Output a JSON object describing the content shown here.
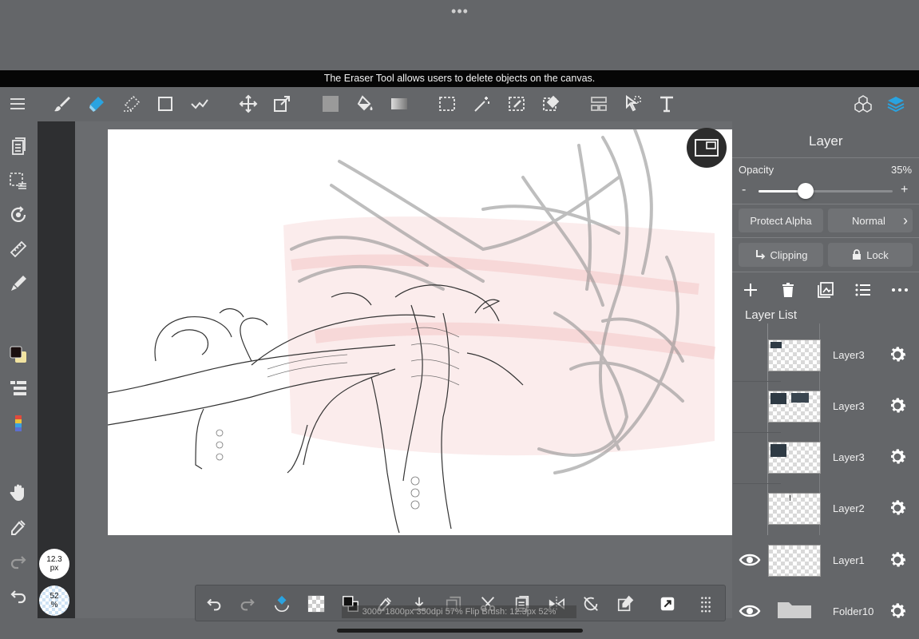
{
  "app": {
    "multitask_dots": "•••",
    "tooltip": "The Eraser Tool allows users to delete objects on the canvas."
  },
  "toolbar": {
    "left_tools": [
      "menu-icon",
      "brush-icon",
      "eraser-icon",
      "blur-eraser-icon",
      "rectangle-icon",
      "pen-bezier-icon",
      "move-icon",
      "transform-icon",
      "fill-color-icon",
      "bucket-icon",
      "gradient-icon",
      "selection-icon",
      "magic-wand-icon",
      "select-pen-icon",
      "select-eraser-icon",
      "layout-icon",
      "select-arrow-icon",
      "text-icon"
    ],
    "right_tools": [
      "materials-icon",
      "layers-icon"
    ],
    "active_tool": "eraser",
    "accent_color": "#2aa3e0"
  },
  "left_sidebar": {
    "tools": [
      "pages-icon",
      "selection-list-icon",
      "rotate-icon",
      "ruler-icon",
      "fill-pen-icon",
      "color-swatch-icon",
      "layer-list-icon",
      "color-palette-icon",
      "hand-icon",
      "eyedropper-icon",
      "redo-icon",
      "undo-icon"
    ],
    "brush_size": {
      "value": "12.3",
      "unit": "px"
    },
    "brush_opacity": {
      "value": "52",
      "unit": "%"
    },
    "primary_color": "#1a0f0f",
    "secondary_color": "#f1e3a0"
  },
  "panel": {
    "title": "Layer",
    "opacity_label": "Opacity",
    "opacity_value": "35%",
    "opacity_fraction": 0.35,
    "minus": "-",
    "plus": "+",
    "protect_alpha": "Protect Alpha",
    "blend_mode": "Normal",
    "clipping": "Clipping",
    "lock": "Lock",
    "layer_list_label": "Layer List",
    "layers": [
      {
        "name": "Layer3",
        "visible": false
      },
      {
        "name": "Layer3",
        "visible": false
      },
      {
        "name": "Layer3",
        "visible": false
      },
      {
        "name": "Layer2",
        "visible": false
      },
      {
        "name": "Layer1",
        "visible": true
      },
      {
        "name": "Folder10",
        "visible": true
      }
    ]
  },
  "bottom_bar": {
    "tools": [
      "undo-icon",
      "redo-icon",
      "transform-select-icon",
      "transparent-icon",
      "color-swap-icon",
      "eyedropper-icon",
      "save-icon",
      "copy-icon",
      "cut-icon",
      "paste-icon",
      "flip-icon",
      "rotate-off-icon",
      "edit-icon",
      "export-icon",
      "grid-icon"
    ]
  },
  "status": "3000*1800px 350dpi 57% Flip Brush: 12.3px 52%"
}
